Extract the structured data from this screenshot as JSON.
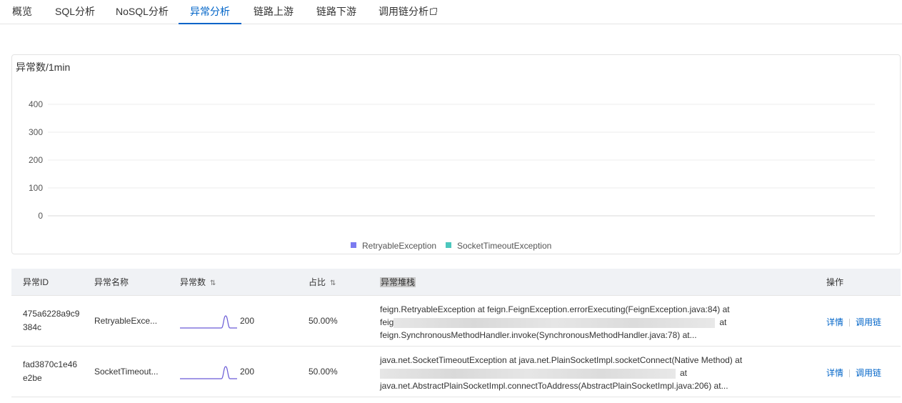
{
  "tabs": [
    {
      "label": "概览",
      "active": false
    },
    {
      "label": "SQL分析",
      "active": false
    },
    {
      "label": "NoSQL分析",
      "active": false
    },
    {
      "label": "异常分析",
      "active": true
    },
    {
      "label": "链路上游",
      "active": false
    },
    {
      "label": "链路下游",
      "active": false
    },
    {
      "label": "调用链分析",
      "active": false,
      "external": true
    }
  ],
  "chart": {
    "title": "异常数/1min"
  },
  "chart_data": {
    "type": "line",
    "title": "异常数/1min",
    "xlabel": "",
    "ylabel": "",
    "ylim": [
      0,
      400
    ],
    "yticks": [
      "400",
      "300",
      "200",
      "100",
      "0"
    ],
    "grid": true,
    "legend_position": "bottom-center",
    "series": [
      {
        "name": "RetryableException",
        "color": "#7b7bf0",
        "values": []
      },
      {
        "name": "SocketTimeoutException",
        "color": "#4cc7bd",
        "values": []
      }
    ]
  },
  "table": {
    "headers": {
      "id": "异常ID",
      "name": "异常名称",
      "count": "异常数",
      "pct": "占比",
      "stack": "异常堆栈",
      "ops": "操作"
    },
    "sort_icon": "⇅",
    "rows": [
      {
        "id": "475a6228a9c9384c",
        "name": "RetryableExce...",
        "count": "200",
        "pct": "50.00%",
        "stack_line1": "feign.RetryableException at feign.FeignException.errorExecuting(FeignException.java:84) at",
        "stack_line2_prefix": "feig",
        "stack_line2_suffix": "at",
        "stack_line3": "feign.SynchronousMethodHandler.invoke(SynchronousMethodHandler.java:78) at...",
        "action_detail": "详情",
        "action_trace": "调用链"
      },
      {
        "id": "fad3870c1e46e2be",
        "name": "SocketTimeout...",
        "count": "200",
        "pct": "50.00%",
        "stack_line1": "java.net.SocketTimeoutException at java.net.PlainSocketImpl.socketConnect(Native Method) at",
        "stack_line2_prefix": "",
        "stack_line2_suffix": "at",
        "stack_line3": "java.net.AbstractPlainSocketImpl.connectToAddress(AbstractPlainSocketImpl.java:206) at...",
        "action_detail": "详情",
        "action_trace": "调用链"
      }
    ],
    "spark_color": "#6a5bd6"
  }
}
